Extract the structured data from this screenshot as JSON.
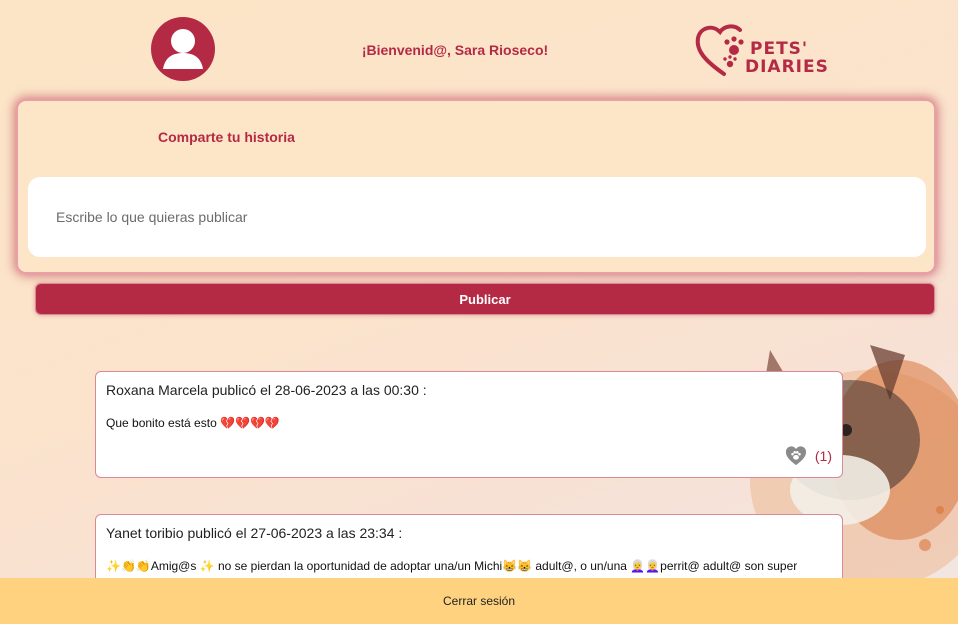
{
  "header": {
    "avatar_icon": "user-avatar-icon",
    "welcome_text": "¡Bienvenid@, Sara Rioseco!",
    "logo": {
      "line1": "PETS'",
      "line2": "DIARIES",
      "icon": "heart-paw-logo-icon"
    }
  },
  "composer": {
    "title": "Comparte tu historia",
    "placeholder": "Escribe lo que quieras publicar",
    "value": "",
    "publish_label": "Publicar"
  },
  "posts": [
    {
      "header": "Roxana Marcela publicó el 28-06-2023 a las 00:30 :",
      "body": "Que bonito está esto 💔💔💔💔",
      "like_icon": "paw-heart-icon",
      "likes": "(1)"
    },
    {
      "header": "Yanet toribio publicó el 27-06-2023 a las 23:34 :",
      "body": "✨👏👏Amig@s ✨ no se pierdan la oportunidad de adoptar una/un Michi😸😸 adult@, o un/una 👩‍🦳👩‍🦳perrit@ adult@ son super"
    }
  ],
  "footer": {
    "logout_label": "Cerrar sesión"
  },
  "colors": {
    "accent": "#b42a45",
    "footer_bg": "#ffd27f",
    "card_bg": "#fde6c8"
  }
}
